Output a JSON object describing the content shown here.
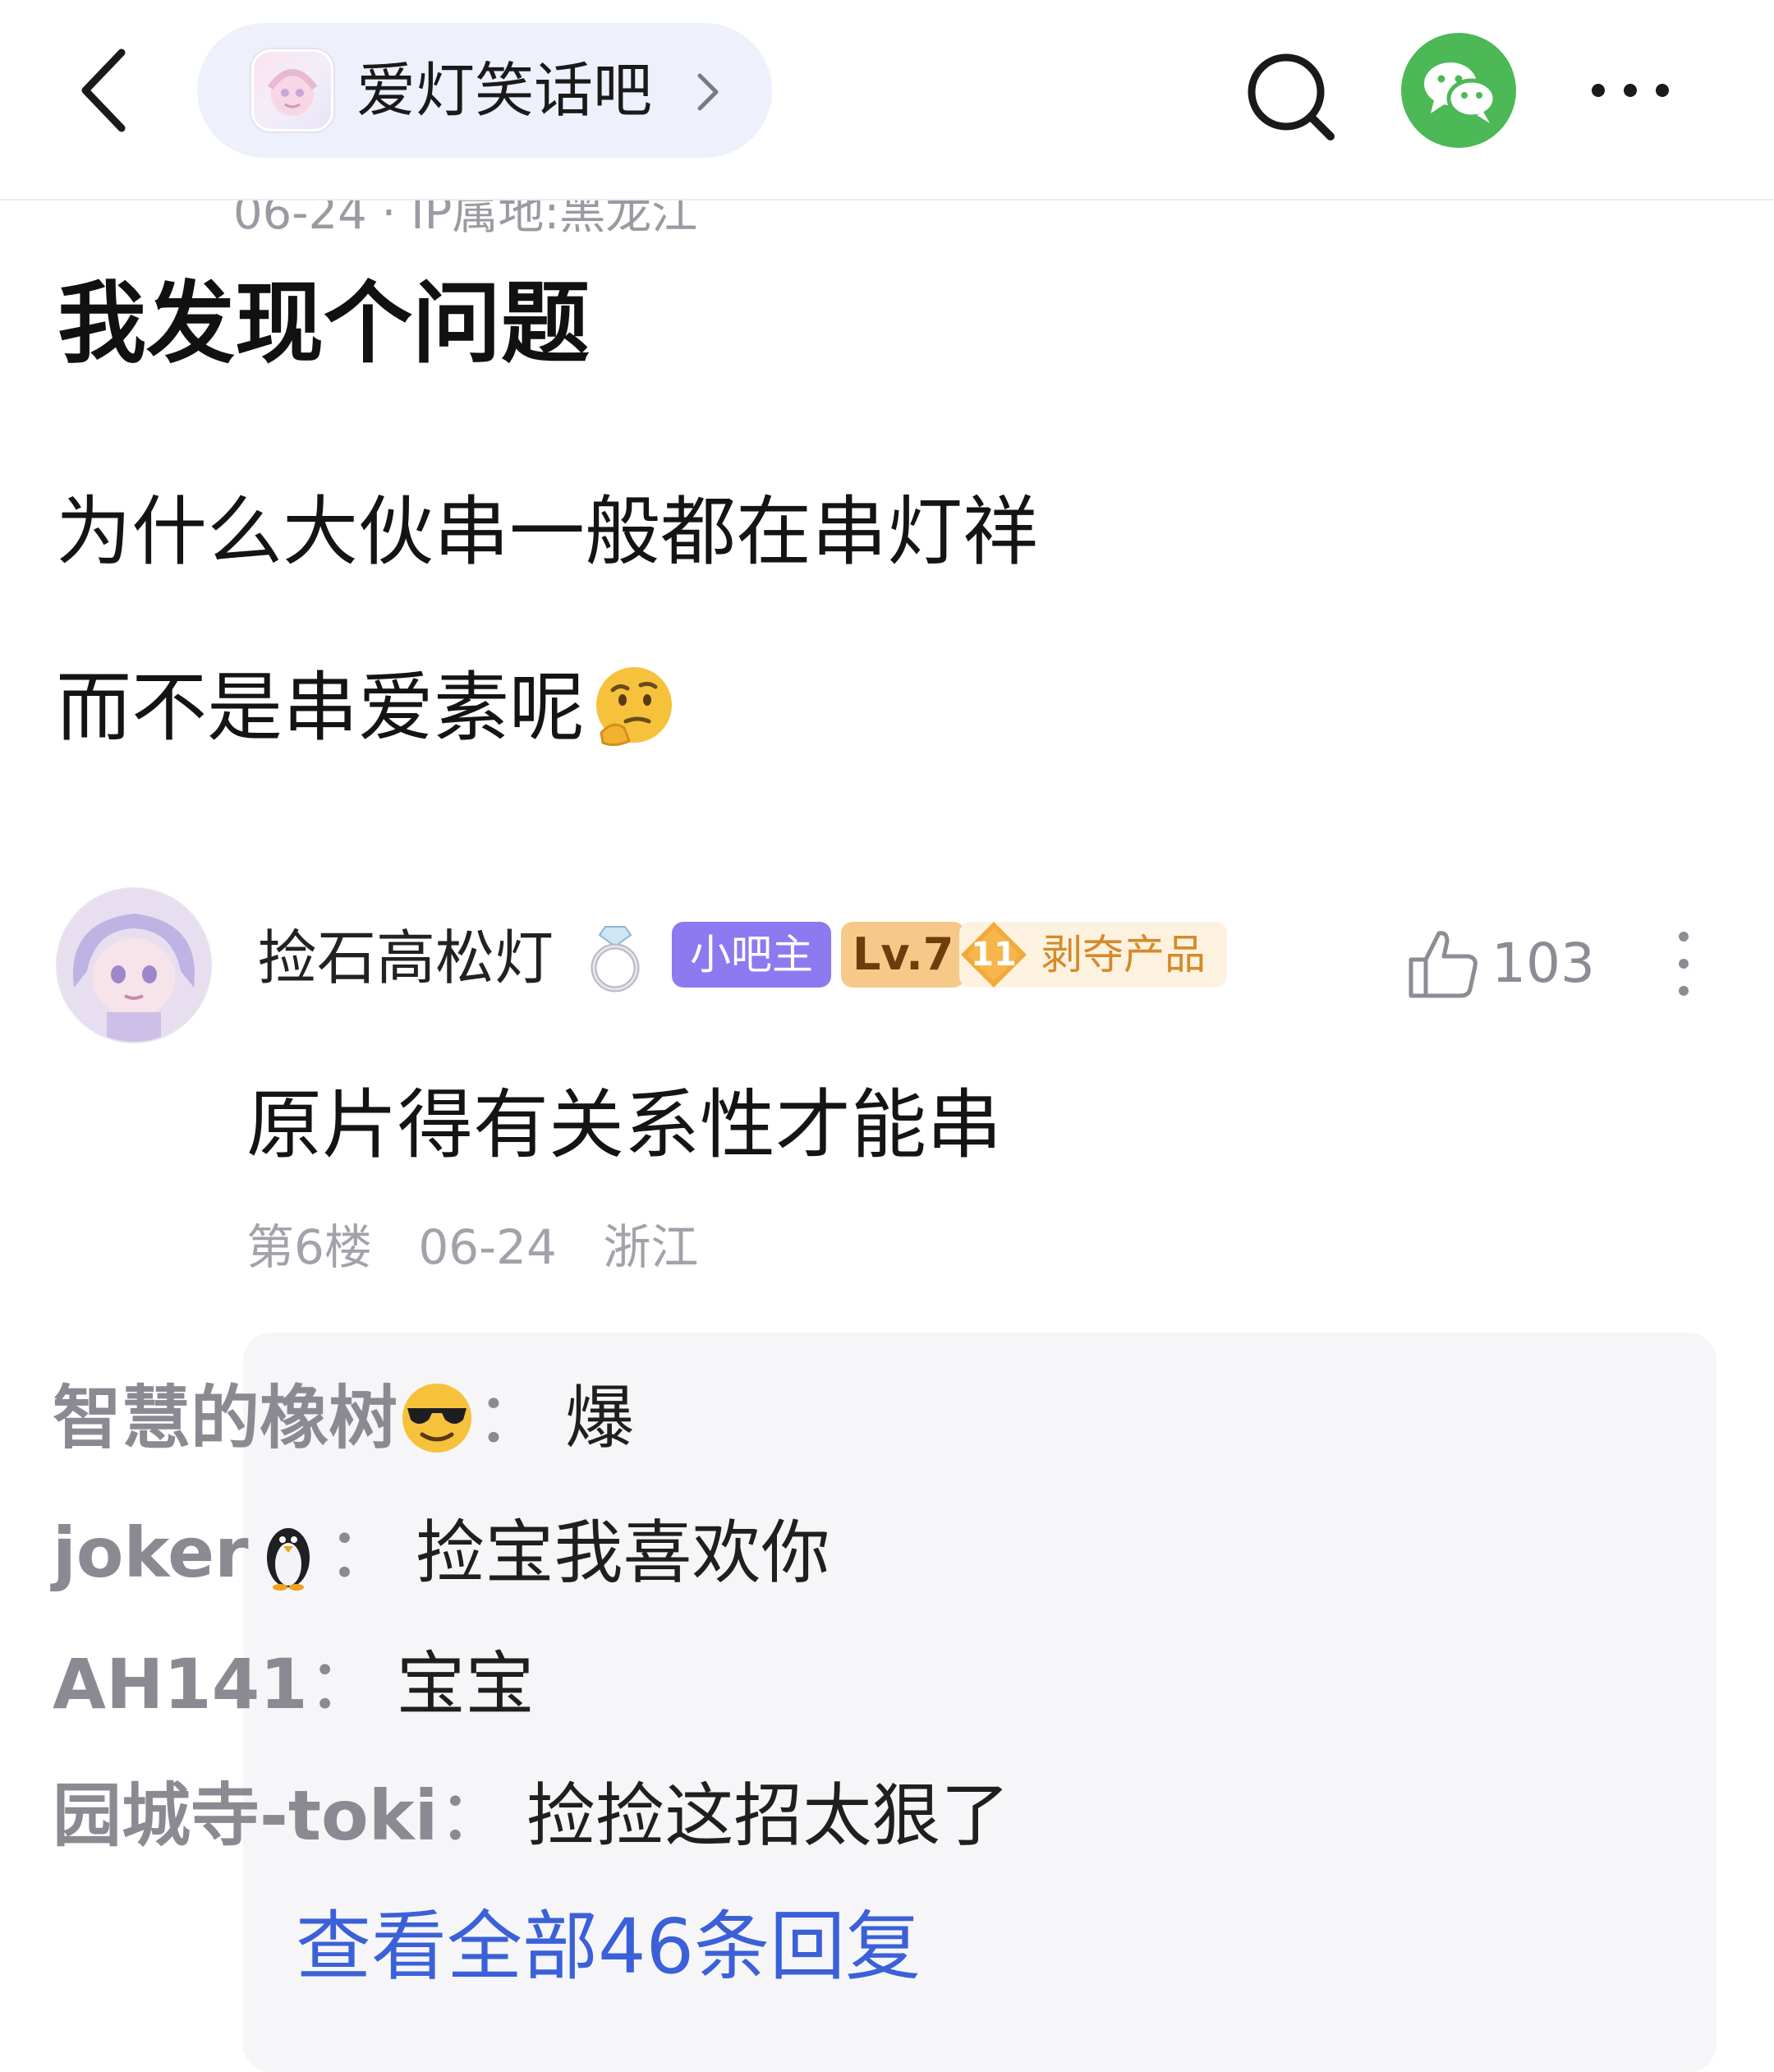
{
  "header": {
    "forum_name": "爱灯笑话吧",
    "icons": {
      "back": "back-chevron-icon",
      "forward": "chevron-right-icon",
      "search": "search-icon",
      "share": "wechat-icon",
      "more": "more-dots-icon"
    },
    "colors": {
      "pill_bg": "#eef0fc",
      "wechat_green": "#4cb856"
    }
  },
  "post": {
    "partial_meta": "06-24 · IP属地:黑龙江",
    "title": "我发现个问题",
    "body_line_1": "为什么大伙串一般都在串灯祥",
    "body_line_2": "而不是串爱素呢",
    "body_emoji": "thinking-face-icon"
  },
  "comment": {
    "username": "捡石高松灯",
    "username_emoji": "ring-icon",
    "badges": {
      "moderator": "小吧主",
      "level": "Lv.7",
      "title_number": "11",
      "title_text": "剥夺产品"
    },
    "likes": "103",
    "text": "原片得有关系性才能串",
    "floor": "第6楼",
    "date": "06-24",
    "location": "浙江",
    "colors": {
      "moderator_badge": "#8d79f0",
      "level_badge": "#f7c988",
      "title_badge_text": "#d48a2b"
    }
  },
  "replies": {
    "items": [
      {
        "name": "智慧的橡树",
        "emoji": "sunglasses-face-icon",
        "sep": "：",
        "text": "爆"
      },
      {
        "name": "joker",
        "emoji": "penguin-icon",
        "sep": "：",
        "text": "捡宝我喜欢你"
      },
      {
        "name": "AH141",
        "emoji": "",
        "sep": "：",
        "text": "宝宝"
      },
      {
        "name": "园城寺-toki",
        "emoji": "",
        "sep": "：",
        "text": "捡捡这招太狠了"
      }
    ],
    "view_all": "查看全部46条回复",
    "colors": {
      "panel_bg": "#f6f6f8",
      "link_blue": "#3b60d8"
    }
  }
}
